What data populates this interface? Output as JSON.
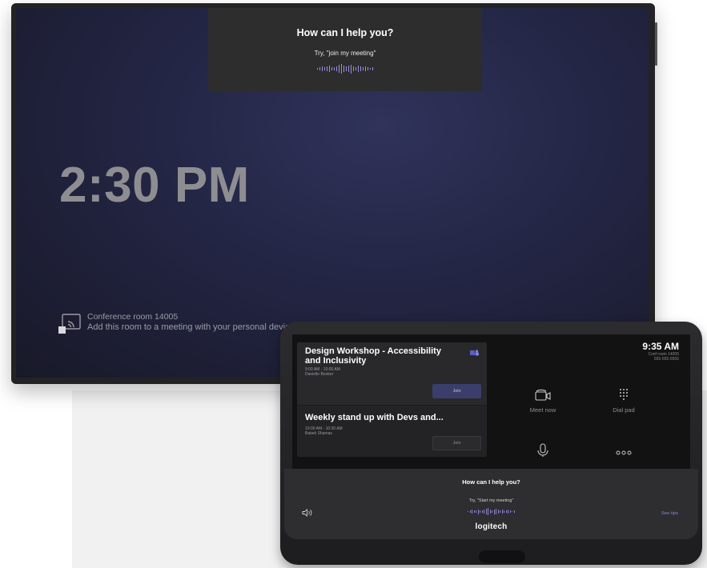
{
  "tv": {
    "cortana_title": "How can I help you?",
    "cortana_hint": "Try, \"join my meeting\"",
    "time": "2:30 PM",
    "room_name": "Conference room 14005",
    "room_hint": "Add this room to a meeting with your personal device"
  },
  "tablet": {
    "clock": "9:35 AM",
    "room": "Conf room 14005",
    "phone": "555-555-5555",
    "meetings": [
      {
        "title": "Design Workshop - Accessibility and Inclusivity",
        "time": "9:00 AM - 10:00 AM",
        "organizer": "Danielle Booker",
        "join": "Join"
      },
      {
        "title": "Weekly stand up with Devs and...",
        "time": "10:00 AM - 10:30 AM",
        "organizer": "Babek Shamas",
        "join": "Join"
      }
    ],
    "tiles": {
      "meet_now": "Meet now",
      "dial_pad": "Dial pad"
    },
    "voice_title": "How can I help you?",
    "voice_hint": "Try, \"Start my meeting\"",
    "see_tips": "See tips",
    "brand": "logitech"
  },
  "icons": [
    "cast-icon",
    "teams-icon",
    "camera-icon",
    "dialpad-icon",
    "microphone-icon",
    "more-icon",
    "speaker-icon",
    "voice-wave-icon"
  ],
  "colors": {
    "accent": "#3b3d6b",
    "wave": "#9a8fe0",
    "link": "#7f8cdc"
  }
}
